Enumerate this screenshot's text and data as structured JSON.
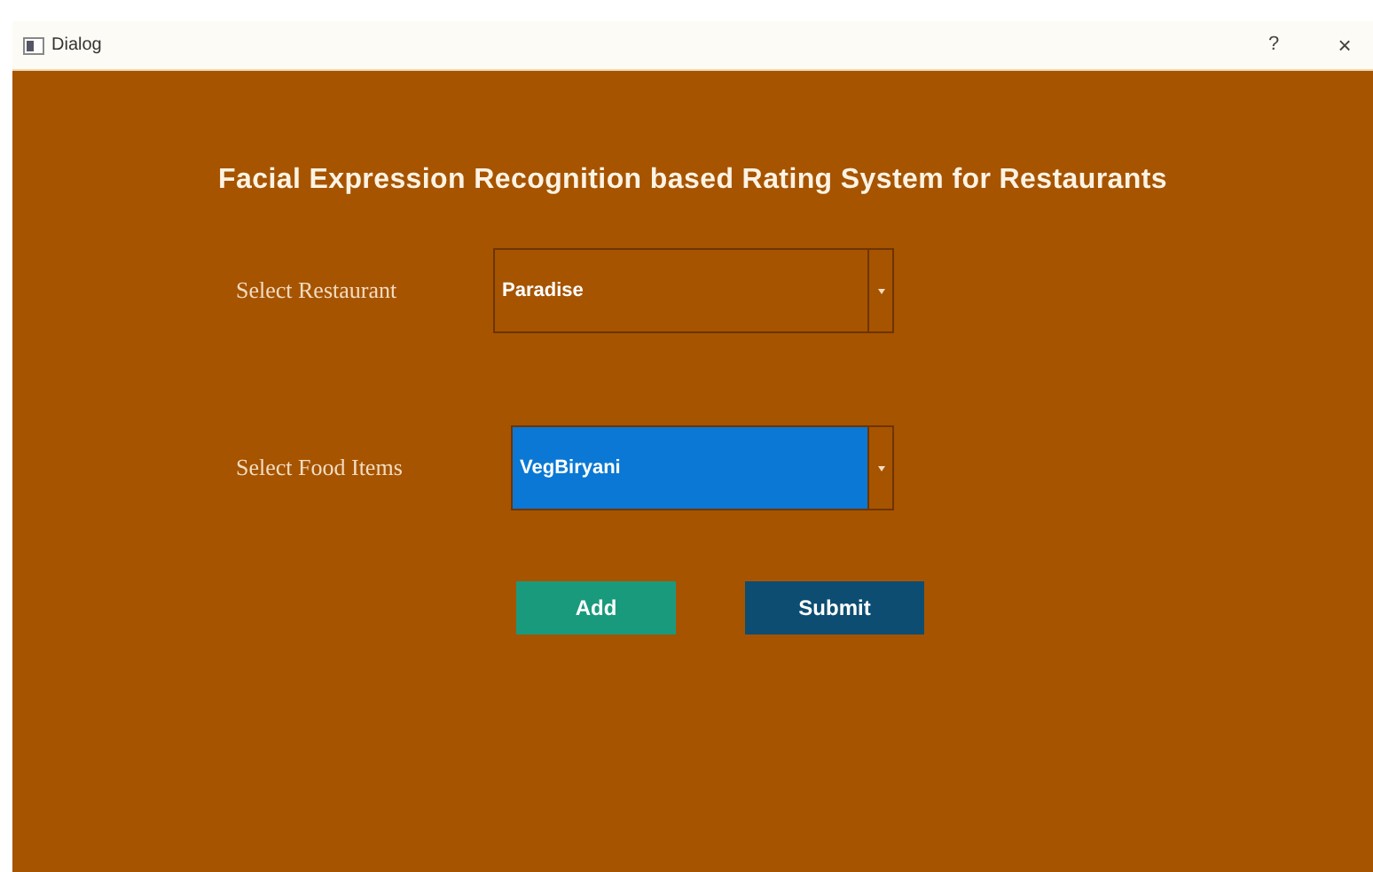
{
  "window": {
    "title": "Dialog",
    "help": "?",
    "close": "×"
  },
  "heading": "Facial Expression Recognition based Rating System for Restaurants",
  "fields": [
    {
      "label": "Select Restaurant",
      "value": "Paradise",
      "focused": false
    },
    {
      "label": "Select Food Items",
      "value": "VegBiryani",
      "focused": true
    }
  ],
  "buttons": [
    {
      "label": "Add",
      "kind": "add"
    },
    {
      "label": "Submit",
      "kind": "submit"
    }
  ]
}
